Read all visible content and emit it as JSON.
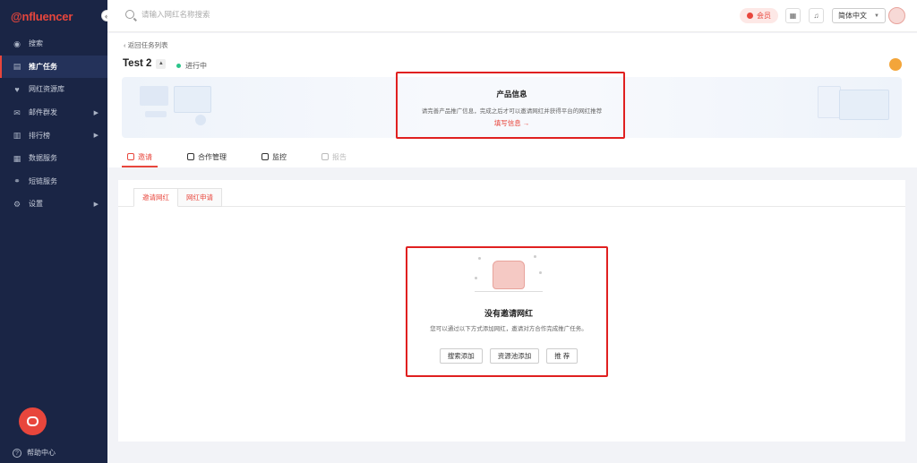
{
  "app": {
    "logo_prefix": "@",
    "logo_text": "nfluencer",
    "collapse_glyph": "«"
  },
  "sidebar": {
    "items": [
      {
        "label": "搜索",
        "icon": "compass-icon",
        "glyph": "◉",
        "has_arrow": false
      },
      {
        "label": "推广任务",
        "icon": "document-icon",
        "glyph": "▤",
        "has_arrow": false,
        "active": true
      },
      {
        "label": "网红资源库",
        "icon": "heart-icon",
        "glyph": "♥",
        "has_arrow": false
      },
      {
        "label": "邮件群发",
        "icon": "mail-icon",
        "glyph": "✉",
        "has_arrow": true
      },
      {
        "label": "排行榜",
        "icon": "bar-chart-icon",
        "glyph": "▥",
        "has_arrow": true
      },
      {
        "label": "数据服务",
        "icon": "data-icon",
        "glyph": "▦",
        "has_arrow": false
      },
      {
        "label": "短链服务",
        "icon": "link-icon",
        "glyph": "⚭",
        "has_arrow": false
      },
      {
        "label": "设置",
        "icon": "gear-icon",
        "glyph": "⚙",
        "has_arrow": true
      }
    ],
    "arrow_glyph": "▶",
    "help_label": "帮助中心"
  },
  "header": {
    "search_placeholder": "请输入网红名称搜索",
    "member_label": "会员",
    "language": "简体中文",
    "grid_glyph": "▦",
    "bell_glyph": "♫"
  },
  "task": {
    "back_label": "返回任务列表",
    "title": "Test 2",
    "title_toggle": "▲",
    "status": "进行中",
    "status_color": "#2bc48a"
  },
  "banner": {
    "title": "产品信息",
    "description": "请完善产品推广信息，完成之后才可以邀请网红并获得平台的网红推荐",
    "link": "填写信息 →"
  },
  "tabs": [
    {
      "label": "邀请",
      "icon": "user-icon",
      "active": true
    },
    {
      "label": "合作管理",
      "icon": "handshake-icon"
    },
    {
      "label": "监控",
      "icon": "monitor-icon"
    },
    {
      "label": "报告",
      "icon": "report-icon",
      "disabled": true
    }
  ],
  "subtabs": [
    {
      "label": "邀请网红",
      "active": true
    },
    {
      "label": "网红申请"
    }
  ],
  "empty_state": {
    "title": "没有邀请网红",
    "description": "您可以通过以下方式添加网红，邀请对方合作完成推广任务。",
    "buttons": [
      "搜索添加",
      "资源池添加",
      "推 荐"
    ]
  },
  "colors": {
    "accent": "#e8463c",
    "sidebar_bg": "#1a2545",
    "highlight": "#e02020"
  }
}
